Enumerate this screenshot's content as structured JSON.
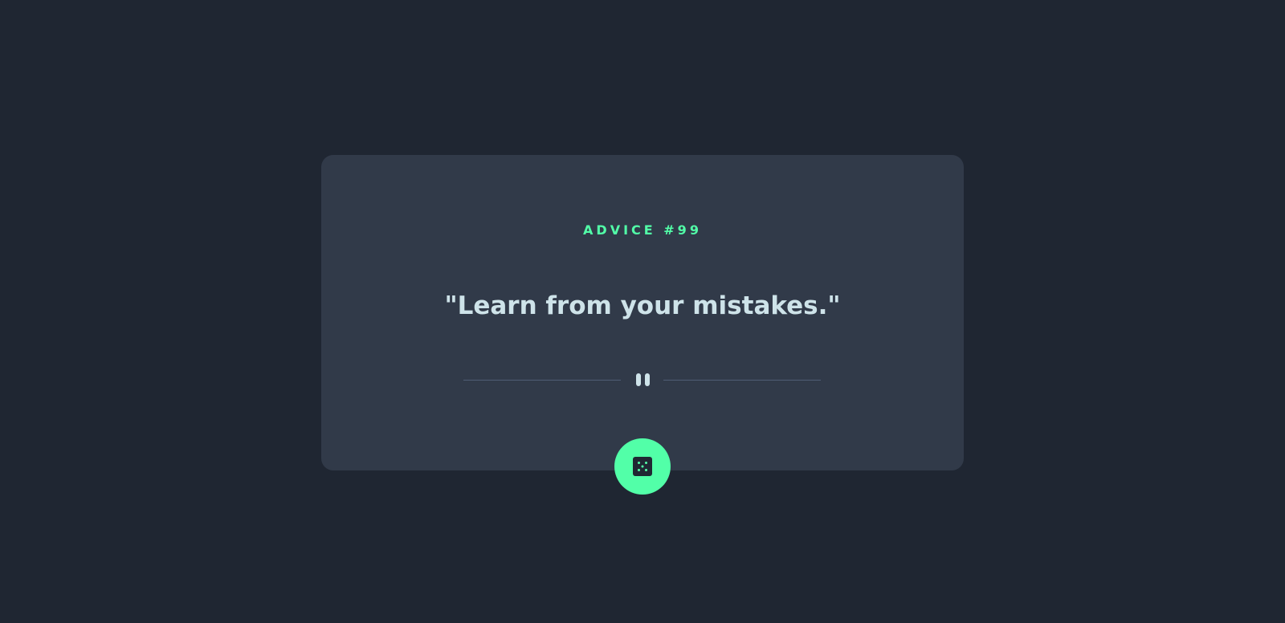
{
  "advice": {
    "label": "ADVICE #99",
    "quote": "\"Learn from your mistakes.\""
  },
  "icons": {
    "divider": "pause-icon",
    "button": "dice-icon"
  },
  "colors": {
    "background": "#1f2632",
    "card": "#313a49",
    "accent": "#52ffa8",
    "text": "#cee3e9",
    "divider": "#4f5d74"
  }
}
